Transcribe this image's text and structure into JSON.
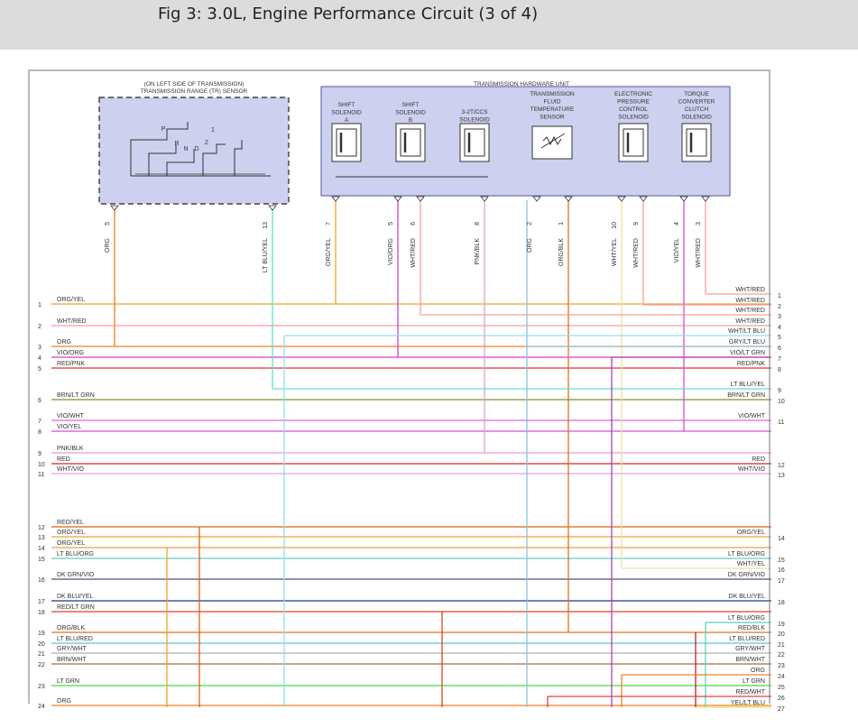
{
  "page_title": "Fig 3: 3.0L, Engine Performance Circuit (3 of 4)",
  "components": {
    "tr_sensor": {
      "label_lines": [
        "(ON LEFT SIDE OF TRANSMISSION)",
        "TRANSMISSION RANGE (TR) SENSOR"
      ],
      "switch_positions": [
        "P",
        "R",
        "N",
        "D",
        "2",
        "1"
      ]
    },
    "thu": {
      "label": "TRANSMISSION HARDWARE UNIT",
      "devices": [
        {
          "label_lines": [
            "SHIFT",
            "SOLENOID",
            "A"
          ],
          "type": "solenoid"
        },
        {
          "label_lines": [
            "SHIFT",
            "SOLENOID",
            "B"
          ],
          "type": "solenoid"
        },
        {
          "label_lines": [
            "3-2T/CCS",
            "SOLENOID"
          ],
          "type": "solenoid"
        },
        {
          "label_lines": [
            "TRANSMISSION",
            "FLUID",
            "TEMPERATURE",
            "SENSOR"
          ],
          "type": "sensor"
        },
        {
          "label_lines": [
            "ELECTRONIC",
            "PRESSURE",
            "CONTROL",
            "SOLENOID"
          ],
          "type": "solenoid"
        },
        {
          "label_lines": [
            "TORQUE",
            "CONVERTER",
            "CLUTCH",
            "SOLENOID"
          ],
          "type": "solenoid"
        }
      ]
    }
  },
  "connector_pins": [
    {
      "pin": "5",
      "wire": "ORG"
    },
    {
      "pin": "13",
      "wire": "LT BLU/YEL"
    },
    {
      "pin": "7",
      "wire": "ORG/YEL"
    },
    {
      "pin": "5",
      "wire": "VIO/ORG"
    },
    {
      "pin": "6",
      "wire": "WHT/RED"
    },
    {
      "pin": "8",
      "wire": "PNK/BLK"
    },
    {
      "pin": "2",
      "wire": "ORG"
    },
    {
      "pin": "1",
      "wire": "ORG/BLK"
    },
    {
      "pin": "10",
      "wire": "WHT/YEL"
    },
    {
      "pin": "9",
      "wire": "WHT/RED"
    },
    {
      "pin": "4",
      "wire": "VIO/YEL"
    },
    {
      "pin": "3",
      "wire": "WHT/RED"
    }
  ],
  "left_bus": [
    {
      "num": "1",
      "label": "ORG/YEL",
      "color": "#f0a030"
    },
    {
      "num": "2",
      "label": "WHT/RED",
      "color": "#f4a0a0"
    },
    {
      "num": "3",
      "label": "ORG",
      "color": "#f08020"
    },
    {
      "num": "4",
      "label": "VIO/ORG",
      "color": "#cc44cc"
    },
    {
      "num": "5",
      "label": "RED/PNK",
      "color": "#e03030"
    },
    {
      "num": "6",
      "label": "BRN/LT GRN",
      "color": "#809020"
    },
    {
      "num": "7",
      "label": "VIO/WHT",
      "color": "#dd66dd"
    },
    {
      "num": "8",
      "label": "VIO/YEL",
      "color": "#d050d0"
    },
    {
      "num": "9",
      "label": "PNK/BLK",
      "color": "#e0a0d0"
    },
    {
      "num": "10",
      "label": "RED",
      "color": "#e02020"
    },
    {
      "num": "11",
      "label": "WHT/VIO",
      "color": "#e0a0f0"
    },
    {
      "num": "12",
      "label": "RED/YEL",
      "color": "#e06010"
    },
    {
      "num": "13",
      "label": "ORG/YEL",
      "color": "#f0a030"
    },
    {
      "num": "14",
      "label": "ORG/YEL",
      "color": "#f0a030"
    },
    {
      "num": "15",
      "label": "LT BLU/ORG",
      "color": "#60d0c0"
    },
    {
      "num": "16",
      "label": "DK GRN/VIO",
      "color": "#505070"
    },
    {
      "num": "17",
      "label": "DK BLU/YEL",
      "color": "#203090"
    },
    {
      "num": "18",
      "label": "RED/LT GRN",
      "color": "#e04020"
    },
    {
      "num": "19",
      "label": "ORG/BLK",
      "color": "#e07020"
    },
    {
      "num": "20",
      "label": "LT BLU/RED",
      "color": "#60c0e0"
    },
    {
      "num": "21",
      "label": "GRY/WHT",
      "color": "#b0b0b0"
    },
    {
      "num": "22",
      "label": "BRN/WHT",
      "color": "#a07040"
    },
    {
      "num": "23",
      "label": "LT GRN",
      "color": "#40e040"
    },
    {
      "num": "24",
      "label": "ORG",
      "color": "#f08020"
    }
  ],
  "right_bus": [
    {
      "num": "1",
      "label": "WHT/RED",
      "color": "#f4a0a0"
    },
    {
      "num": "2",
      "label": "WHT/RED",
      "color": "#f4a0a0"
    },
    {
      "num": "3",
      "label": "WHT/RED",
      "color": "#f4a0a0"
    },
    {
      "num": "4",
      "label": "WHT/RED",
      "color": "#f4a0a0"
    },
    {
      "num": "5",
      "label": "WHT/LT BLU",
      "color": "#90e0f0"
    },
    {
      "num": "6",
      "label": "GRY/LT BLU",
      "color": "#90c0e0"
    },
    {
      "num": "7",
      "label": "VIO/LT GRN",
      "color": "#b040b0"
    },
    {
      "num": "8",
      "label": "RED/PNK",
      "color": "#e03030"
    },
    {
      "num": "9",
      "label": "LT BLU/YEL",
      "color": "#60e0d0"
    },
    {
      "num": "10",
      "label": "BRN/LT GRN",
      "color": "#809020"
    },
    {
      "num": "11",
      "label": "VIO/WHT",
      "color": "#dd66dd"
    },
    {
      "num": "12",
      "label": "RED",
      "color": "#e02020"
    },
    {
      "num": "13",
      "label": "WHT/VIO",
      "color": "#e0a0f0"
    },
    {
      "num": "14",
      "label": "ORG/YEL",
      "color": "#f0a030"
    },
    {
      "num": "15",
      "label": "LT BLU/ORG",
      "color": "#60d0c0"
    },
    {
      "num": "16",
      "label": "WHT/YEL",
      "color": "#f0e0a0"
    },
    {
      "num": "17",
      "label": "DK GRN/VIO",
      "color": "#505070"
    },
    {
      "num": "18",
      "label": "DK BLU/YEL",
      "color": "#203090"
    },
    {
      "num": "19",
      "label": "LT BLU/ORG",
      "color": "#60d0c0"
    },
    {
      "num": "20",
      "label": "RED/BLK",
      "color": "#c02020"
    },
    {
      "num": "21",
      "label": "LT BLU/RED",
      "color": "#60c0e0"
    },
    {
      "num": "22",
      "label": "GRY/WHT",
      "color": "#b0b0b0"
    },
    {
      "num": "23",
      "label": "BRN/WHT",
      "color": "#a07040"
    },
    {
      "num": "24",
      "label": "ORG",
      "color": "#f08020"
    },
    {
      "num": "25",
      "label": "LT GRN",
      "color": "#40e040"
    },
    {
      "num": "26",
      "label": "RED/WHT",
      "color": "#e04040"
    },
    {
      "num": "27",
      "label": "YEL/LT BLU",
      "color": "#e0e060"
    }
  ],
  "colors": {
    "header_bg": "#dcdcdc",
    "component_fill": "#cdd0ee",
    "component_stroke": "#6a6fb0"
  }
}
